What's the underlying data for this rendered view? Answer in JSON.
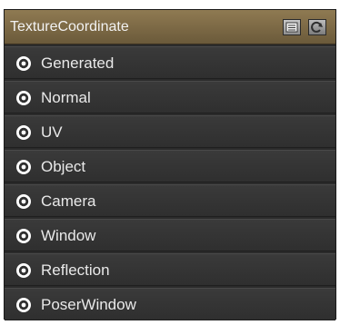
{
  "node": {
    "title": "TextureCoordinate",
    "header_buttons": [
      {
        "icon": "menu-icon"
      },
      {
        "icon": "refresh-icon"
      }
    ],
    "outputs": [
      {
        "label": "Generated",
        "icon": "output-socket-icon"
      },
      {
        "label": "Normal",
        "icon": "output-socket-icon"
      },
      {
        "label": "UV",
        "icon": "output-socket-icon"
      },
      {
        "label": "Object",
        "icon": "output-socket-icon"
      },
      {
        "label": "Camera",
        "icon": "output-socket-icon"
      },
      {
        "label": "Window",
        "icon": "output-socket-icon"
      },
      {
        "label": "Reflection",
        "icon": "output-socket-icon"
      },
      {
        "label": "PoserWindow",
        "icon": "output-socket-icon"
      }
    ]
  },
  "colors": {
    "header": "#7a6647",
    "row": "#353535",
    "text": "#e9e9e9",
    "socket": "#ffffff"
  }
}
